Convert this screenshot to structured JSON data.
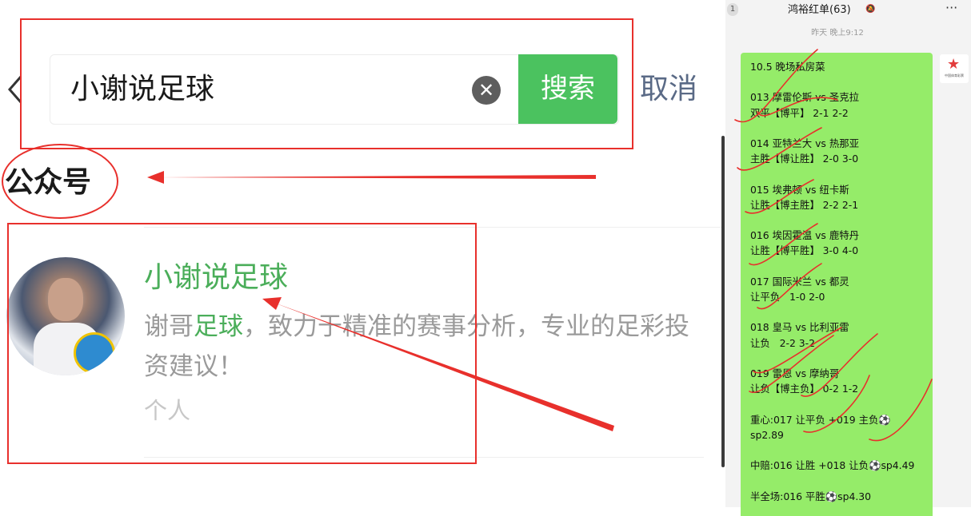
{
  "search": {
    "query": "小谢说足球",
    "button_label": "搜索",
    "cancel_label": "取消"
  },
  "section": {
    "title": "公众号"
  },
  "result": {
    "name": "小谢说足球",
    "desc_prefix": "谢哥",
    "desc_highlight": "足球",
    "desc_rest": "，致力于精准的赛事分析，专业的足彩投资建议！",
    "type": "个人"
  },
  "chat": {
    "badge": "1",
    "title": "鸿裕红单(63)",
    "more": "···",
    "timestamp": "昨天 晚上9:12",
    "message": "10.5 晚场私房菜\n\n013 摩雷伦斯 vs 圣克拉\n双平【博平】 2-1 2-2\n\n014 亚特兰大 vs 热那亚\n主胜【博让胜】 2-0 3-0\n\n015 埃弗顿 vs 纽卡斯\n让胜【博主胜】 2-2 2-1\n\n016 埃因霍温 vs 鹿特丹\n让胜【博平胜】 3-0 4-0\n\n017 国际米兰 vs 都灵\n让平负   1-0 2-0\n\n018 皇马 vs 比利亚雷\n让负   2-2 3-2\n\n019 雷恩 vs 摩纳哥\n让负【博主负】 0-2 1-2\n\n重心:017 让平负 +019 主负⚽\nsp2.89\n\n中赔:016 让胜 +018 让负⚽sp4.49\n\n半全场:016 平胜⚽sp4.30",
    "logo_text": "中国体育彩票"
  },
  "colors": {
    "accent_green": "#4bc25f",
    "bubble_green": "#95ec69",
    "annotation_red": "#e8302c"
  }
}
